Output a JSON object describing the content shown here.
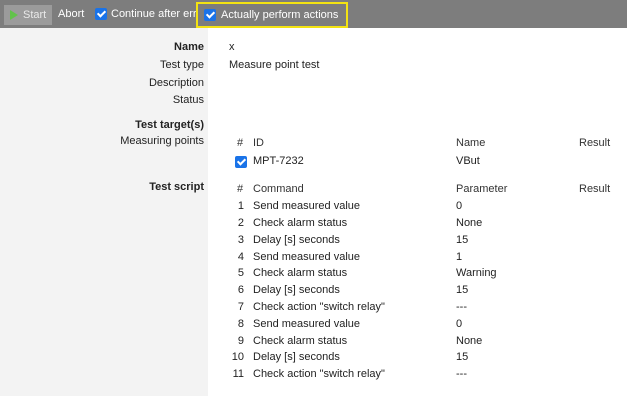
{
  "toolbar": {
    "start_label": "Start",
    "abort_label": "Abort",
    "continue_label": "Continue after error",
    "actually_label": "Actually perform actions",
    "highlight_color": "#f3e312"
  },
  "details": {
    "name_label": "Name",
    "name_value": "x",
    "test_type_label": "Test type",
    "test_type_value": "Measure point test",
    "description_label": "Description",
    "status_label": "Status"
  },
  "targets": {
    "section_label": "Test target(s)",
    "measuring_points_label": "Measuring points",
    "columns": {
      "num": "#",
      "id": "ID",
      "name": "Name",
      "result": "Result"
    },
    "rows": [
      {
        "id": "MPT-7232",
        "name": "VBut",
        "checked": true
      }
    ]
  },
  "script": {
    "section_label": "Test script",
    "columns": {
      "num": "#",
      "command": "Command",
      "parameter": "Parameter",
      "result": "Result"
    },
    "rows": [
      {
        "num": "1",
        "command": "Send measured value",
        "parameter": "0"
      },
      {
        "num": "2",
        "command": "Check alarm status",
        "parameter": "None"
      },
      {
        "num": "3",
        "command": "Delay [s] seconds",
        "parameter": "15"
      },
      {
        "num": "4",
        "command": "Send measured value",
        "parameter": "1"
      },
      {
        "num": "5",
        "command": "Check alarm status",
        "parameter": "Warning"
      },
      {
        "num": "6",
        "command": "Delay [s] seconds",
        "parameter": "15"
      },
      {
        "num": "7",
        "command": "Check action \"switch relay\"",
        "parameter": "---"
      },
      {
        "num": "8",
        "command": "Send measured value",
        "parameter": "0"
      },
      {
        "num": "9",
        "command": "Check alarm status",
        "parameter": "None"
      },
      {
        "num": "10",
        "command": "Delay [s] seconds",
        "parameter": "15"
      },
      {
        "num": "11",
        "command": "Check action \"switch relay\"",
        "parameter": "---"
      }
    ]
  }
}
